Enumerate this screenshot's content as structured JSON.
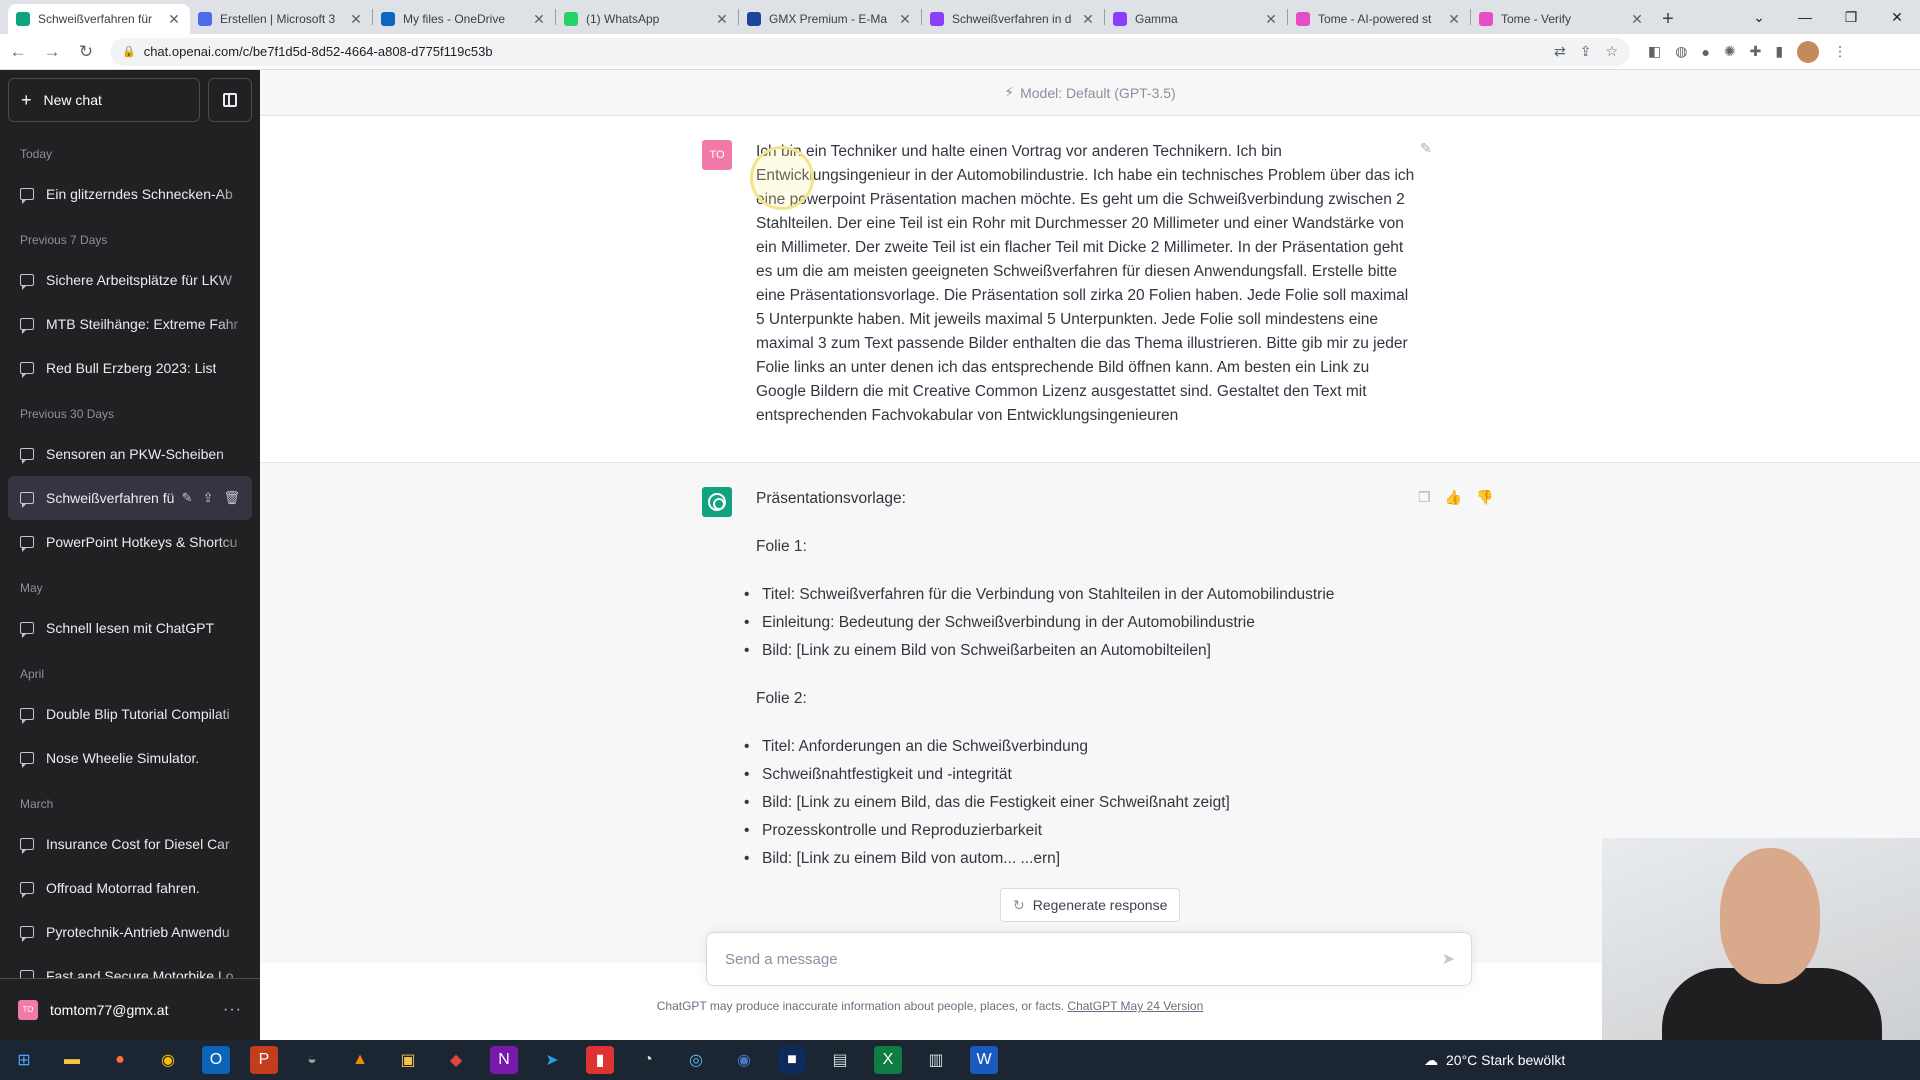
{
  "browser": {
    "tabs": [
      {
        "title": "Schweißverfahren für",
        "color": "#10a37f"
      },
      {
        "title": "Erstellen | Microsoft 3",
        "color": "#4f6bed"
      },
      {
        "title": "My files - OneDrive",
        "color": "#0a66c2"
      },
      {
        "title": "(1) WhatsApp",
        "color": "#25d366"
      },
      {
        "title": "GMX Premium - E-Ma",
        "color": "#1c449b"
      },
      {
        "title": "Schweißverfahren in d",
        "color": "#8a3ffc"
      },
      {
        "title": "Gamma",
        "color": "#8a3ffc"
      },
      {
        "title": "Tome - AI-powered st",
        "color": "#e64ec6"
      },
      {
        "title": "Tome - Verify",
        "color": "#e64ec6"
      }
    ],
    "new_tab": "+",
    "url": "chat.openai.com/c/be7f1d5d-8d52-4664-a808-d775f119c53b"
  },
  "sidebar": {
    "new_chat": "New chat",
    "groups": [
      {
        "label": "Today",
        "items": [
          "Ein glitzerndes Schnecken-Ab"
        ]
      },
      {
        "label": "Previous 7 Days",
        "items": [
          "Sichere Arbeitsplätze für LKW",
          "MTB Steilhänge: Extreme Fahr",
          "Red Bull Erzberg 2023: List"
        ]
      },
      {
        "label": "Previous 30 Days",
        "items": [
          "Sensoren an PKW-Scheiben",
          "Schweißverfahren fü",
          "PowerPoint Hotkeys & Shortcu"
        ]
      },
      {
        "label": "May",
        "items": [
          "Schnell lesen mit ChatGPT"
        ]
      },
      {
        "label": "April",
        "items": [
          "Double Blip Tutorial Compilati",
          "Nose Wheelie Simulator."
        ]
      },
      {
        "label": "March",
        "items": [
          "Insurance Cost for Diesel Car",
          "Offroad Motorrad fahren.",
          "Pyrotechnik-Antrieb Anwendu",
          "Fast and Secure Motorbike Lo"
        ]
      }
    ],
    "selected_item": "Schweißverfahren fü",
    "user": {
      "initials": "TO",
      "email": "tomtom77@gmx.at",
      "more": "···"
    }
  },
  "main": {
    "model": "Model: Default (GPT-3.5)",
    "user_initials": "TO",
    "user_message": "Ich bin ein Techniker und halte einen Vortrag vor anderen Technikern. Ich bin Entwicklungsingenieur in der Automobilindustrie. Ich habe ein technisches Problem über das ich eine powerpoint Präsentation machen möchte. Es geht um die Schweißverbindung zwischen 2 Stahlteilen. Der eine Teil ist ein Rohr mit Durchmesser 20 Millimeter und einer Wandstärke von ein Millimeter. Der zweite Teil ist ein flacher Teil mit Dicke 2 Millimeter. In der Präsentation geht es um die am meisten geeigneten Schweißverfahren für diesen Anwendungsfall. Erstelle bitte eine Präsentationsvorlage. Die Präsentation soll zirka 20 Folien haben. Jede Folie soll maximal 5 Unterpunkte haben. Mit jeweils maximal 5 Unterpunkten. Jede Folie soll mindestens eine maximal 3 zum Text passende Bilder enthalten die das Thema illustrieren. Bitte gib mir zu jeder Folie links an unter denen ich das entsprechende Bild öffnen kann. Am besten ein Link zu Google Bildern die mit Creative Common Lizenz ausgestattet sind. Gestaltet den Text mit entsprechenden Fachvokabular von Entwicklungsingenieuren",
    "assistant": {
      "intro": "Präsentationsvorlage:",
      "slides": [
        {
          "heading": "Folie 1:",
          "bullets": [
            "Titel: Schweißverfahren für die Verbindung von Stahlteilen in der Automobilindustrie",
            "Einleitung: Bedeutung der Schweißverbindung in der Automobilindustrie",
            "Bild: [Link zu einem Bild von Schweißarbeiten an Automobilteilen]"
          ]
        },
        {
          "heading": "Folie 2:",
          "bullets": [
            "Titel: Anforderungen an die Schweißverbindung",
            "Schweißnahtfestigkeit und -integrität",
            "Bild: [Link zu einem Bild, das die Festigkeit einer Schweißnaht zeigt]",
            "Prozesskontrolle und Reproduzierbarkeit",
            "Bild: [Link zu einem Bild von autom... ...ern]"
          ]
        }
      ]
    },
    "regenerate": "Regenerate response",
    "input_placeholder": "Send a message",
    "disclaimer": "ChatGPT may produce inaccurate information about people, places, or facts.",
    "version_link": "ChatGPT May 24 Version"
  },
  "taskbar": {
    "weather": "20°C  Stark bewölkt"
  }
}
